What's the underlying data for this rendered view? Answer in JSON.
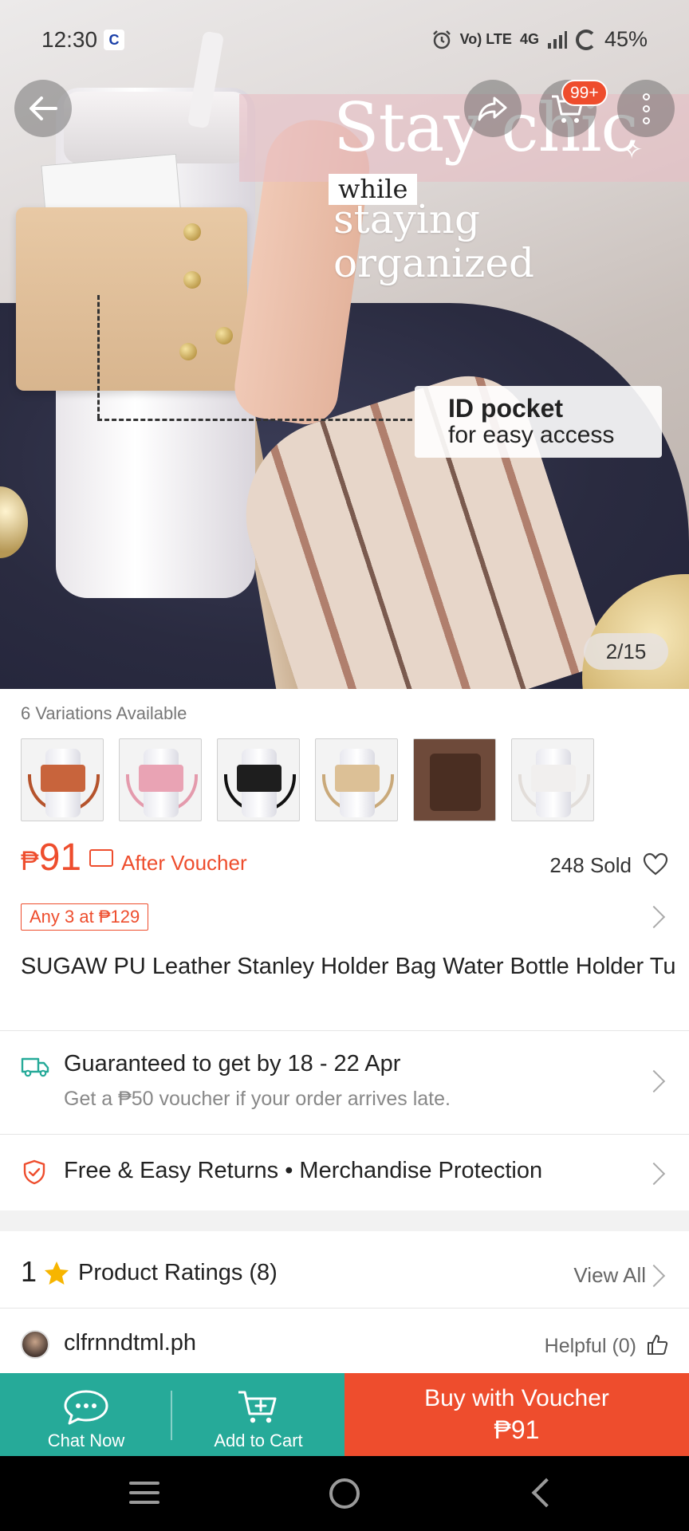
{
  "status_bar": {
    "time": "12:30",
    "app_indicator": "C",
    "volte": "Vo) LTE",
    "network": "4G",
    "battery": "45%"
  },
  "hero": {
    "headline": "Stay chic",
    "tagline_small": "while",
    "tagline": "staying organized",
    "callout_title": "ID pocket",
    "callout_subtitle": "for easy access",
    "page_indicator": "2/15"
  },
  "header": {
    "cart_badge": "99+"
  },
  "product": {
    "variations_label": "6 Variations Available",
    "variations": [
      {
        "color": "#c8643c",
        "strap": "#b5532c"
      },
      {
        "color": "#e9a3b4",
        "strap": "#e49aac"
      },
      {
        "color": "#1e1e1e",
        "strap": "#111111"
      },
      {
        "color": "#dcc096",
        "strap": "#c9a97a"
      },
      {
        "color": "#6e4a3a",
        "strap": "#4a2e22"
      },
      {
        "color": "#f1efee",
        "strap": "#e2ddd9"
      }
    ],
    "price_currency": "₱",
    "price": "91",
    "after_voucher": "After Voucher",
    "sold": "248 Sold",
    "bundle_deal": "Any 3 at ₱129",
    "title": "SUGAW PU Leather Stanley Holder Bag Water Bottle Holder Tumbler Coffee Cup Milk Tea Handle With Adju"
  },
  "shipping": {
    "main": "Guaranteed to get by 18 - 22 Apr",
    "sub": "Get a ₱50 voucher if your order arrives late."
  },
  "returns": {
    "text": "Free & Easy Returns  •  Merchandise Protection"
  },
  "ratings": {
    "score": "1",
    "label": "Product Ratings (8)",
    "view_all": "View All"
  },
  "review": {
    "reviewer": "clfrnndtml.ph",
    "helpful": "Helpful (0)"
  },
  "actions": {
    "chat": "Chat Now",
    "add_to_cart": "Add to Cart",
    "buy_label": "Buy with Voucher",
    "buy_price": "₱91"
  },
  "colors": {
    "accent": "#ee4d2d",
    "teal": "#26aa99"
  }
}
